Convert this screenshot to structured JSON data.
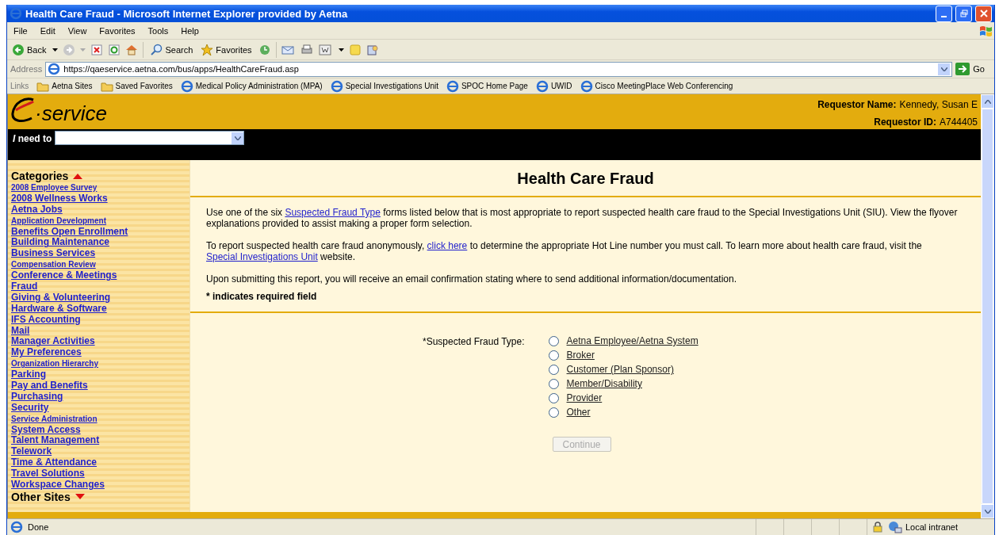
{
  "window": {
    "title": "Health Care Fraud - Microsoft Internet Explorer provided by Aetna"
  },
  "menu": [
    "File",
    "Edit",
    "View",
    "Favorites",
    "Tools",
    "Help"
  ],
  "toolbar": {
    "back": "Back",
    "search": "Search",
    "favorites": "Favorites"
  },
  "address": {
    "label": "Address",
    "value": "https://qaeservice.aetna.com/bus/apps/HealthCareFraud.asp",
    "go": "Go"
  },
  "links": {
    "label": "Links",
    "items": [
      {
        "label": "Aetna Sites",
        "kind": "folder"
      },
      {
        "label": "Saved Favorites",
        "kind": "folder"
      },
      {
        "label": "Medical Policy Administration (MPA)",
        "kind": "page"
      },
      {
        "label": "Special Investigations Unit",
        "kind": "page"
      },
      {
        "label": "SPOC Home Page",
        "kind": "page"
      },
      {
        "label": "UWID",
        "kind": "page"
      },
      {
        "label": "Cisco MeetingPlace Web Conferencing",
        "kind": "page"
      }
    ]
  },
  "header": {
    "logo": "·service",
    "requestor_name_label": "Requestor Name:",
    "requestor_name": "Kennedy, Susan E",
    "requestor_id_label": "Requestor ID:",
    "requestor_id": "A744405"
  },
  "need_to": {
    "label": "*I* need to"
  },
  "sidebar": {
    "heading": "Categories",
    "items": [
      {
        "label": "2008 Employee Survey",
        "kind": "small"
      },
      {
        "label": "2008 Wellness Works",
        "kind": "large"
      },
      {
        "label": "Aetna Jobs",
        "kind": "large"
      },
      {
        "label": "Application Development",
        "kind": "small"
      },
      {
        "label": "Benefits Open Enrollment",
        "kind": "large"
      },
      {
        "label": "Building Maintenance",
        "kind": "large"
      },
      {
        "label": "Business Services",
        "kind": "large"
      },
      {
        "label": "Compensation Review",
        "kind": "small"
      },
      {
        "label": "Conference & Meetings",
        "kind": "large"
      },
      {
        "label": "Fraud",
        "kind": "large"
      },
      {
        "label": "Giving & Volunteering",
        "kind": "large"
      },
      {
        "label": "Hardware & Software",
        "kind": "large"
      },
      {
        "label": "IFS Accounting",
        "kind": "large"
      },
      {
        "label": "Mail",
        "kind": "large"
      },
      {
        "label": "Manager Activities",
        "kind": "large"
      },
      {
        "label": "My Preferences",
        "kind": "large"
      },
      {
        "label": "Organization Hierarchy",
        "kind": "small"
      },
      {
        "label": "Parking",
        "kind": "large"
      },
      {
        "label": "Pay and Benefits",
        "kind": "large"
      },
      {
        "label": "Purchasing",
        "kind": "large"
      },
      {
        "label": "Security",
        "kind": "large"
      },
      {
        "label": "Service Administration",
        "kind": "small"
      },
      {
        "label": "System Access",
        "kind": "large"
      },
      {
        "label": "Talent Management",
        "kind": "large"
      },
      {
        "label": "Telework",
        "kind": "large"
      },
      {
        "label": "Time & Attendance",
        "kind": "large"
      },
      {
        "label": "Travel Solutions",
        "kind": "large"
      },
      {
        "label": "Workspace Changes",
        "kind": "large"
      }
    ],
    "other": "Other Sites"
  },
  "main": {
    "title": "Health Care Fraud",
    "paragraphs": [
      [
        {
          "text": "Use one of the six "
        },
        {
          "text": "Suspected Fraud Type",
          "link": true
        },
        {
          "text": " forms listed below that is most appropriate to report suspected health care fraud to the Special Investigations Unit (SIU).  View the flyover explanations provided to assist making a proper form selection."
        }
      ],
      [
        {
          "text": "To report suspected health care fraud anonymously, "
        },
        {
          "text": "click here",
          "link": true
        },
        {
          "text": " to determine the appropriate Hot Line number you must call.  To learn more about health care fraud, visit the "
        },
        {
          "text": "Special Investigations Unit",
          "link": true
        },
        {
          "text": " website."
        }
      ],
      [
        {
          "text": "Upon submitting this report, you will receive an email confirmation stating where to send additional information/documentation."
        }
      ]
    ],
    "required_note": "* indicates required field",
    "form": {
      "label": "*Suspected Fraud Type:",
      "options": [
        {
          "label": "Aetna Employee/Aetna System",
          "selected": false
        },
        {
          "label": "Broker",
          "selected": false
        },
        {
          "label": "Customer (Plan Sponsor)",
          "selected": false
        },
        {
          "label": "Member/Disability",
          "selected": false
        },
        {
          "label": "Provider",
          "selected": false
        },
        {
          "label": "Other",
          "selected": false
        }
      ],
      "button": {
        "label": "Continue",
        "disabled": true
      }
    }
  },
  "status_bar": {
    "text": "Done",
    "zone": "Local intranet"
  }
}
